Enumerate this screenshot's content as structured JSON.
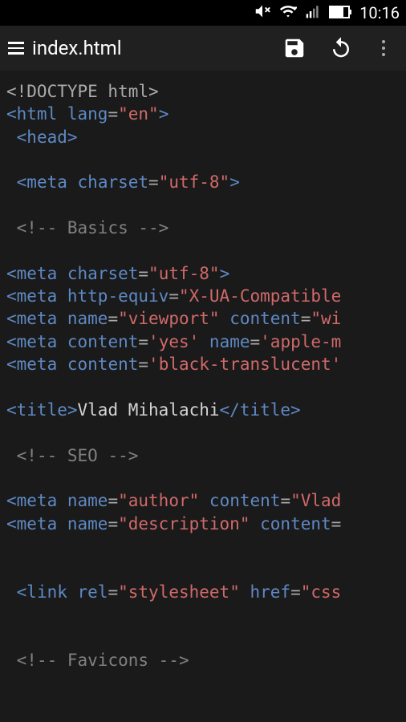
{
  "status": {
    "time": "10:16"
  },
  "appbar": {
    "filename": "index.html"
  },
  "code": {
    "lines": [
      {
        "indent": 0,
        "kind": "doctype",
        "text": "<!DOCTYPE html>"
      },
      {
        "indent": 0,
        "kind": "open",
        "tag": "html",
        "attrs": [
          [
            "lang",
            "\"en\""
          ]
        ]
      },
      {
        "indent": 1,
        "kind": "open",
        "tag": "head"
      },
      {
        "indent": 0,
        "kind": "blank"
      },
      {
        "indent": 1,
        "kind": "self",
        "tag": "meta",
        "attrs": [
          [
            "charset",
            "\"utf-8\""
          ]
        ]
      },
      {
        "indent": 0,
        "kind": "blank"
      },
      {
        "indent": 1,
        "kind": "comment",
        "text": "<!-- Basics -->"
      },
      {
        "indent": 0,
        "kind": "blank"
      },
      {
        "indent": 0,
        "kind": "self",
        "tag": "meta",
        "attrs": [
          [
            "charset",
            "\"utf-8\""
          ]
        ]
      },
      {
        "indent": 0,
        "kind": "self-noclose",
        "tag": "meta",
        "attrs": [
          [
            "http-equiv",
            "\"X-UA-Compatible"
          ]
        ]
      },
      {
        "indent": 0,
        "kind": "self-noclose",
        "tag": "meta",
        "attrs": [
          [
            "name",
            "\"viewport\""
          ],
          [
            "content",
            "\"wi"
          ]
        ]
      },
      {
        "indent": 0,
        "kind": "self-noclose",
        "tag": "meta",
        "attrs": [
          [
            "content",
            "'yes'"
          ],
          [
            "name",
            "'apple-m"
          ]
        ]
      },
      {
        "indent": 0,
        "kind": "self-noclose",
        "tag": "meta",
        "attrs": [
          [
            "content",
            "'black-translucent'"
          ]
        ]
      },
      {
        "indent": 0,
        "kind": "blank"
      },
      {
        "indent": 0,
        "kind": "element",
        "tag": "title",
        "inner": "Vlad Mihalachi"
      },
      {
        "indent": 0,
        "kind": "blank"
      },
      {
        "indent": 1,
        "kind": "comment",
        "text": "<!-- SEO -->"
      },
      {
        "indent": 0,
        "kind": "blank"
      },
      {
        "indent": 0,
        "kind": "self-noclose",
        "tag": "meta",
        "attrs": [
          [
            "name",
            "\"author\""
          ],
          [
            "content",
            "\"Vlad"
          ]
        ]
      },
      {
        "indent": 0,
        "kind": "self-noclose",
        "tag": "meta",
        "attrs": [
          [
            "name",
            "\"description\""
          ],
          [
            "content",
            ""
          ]
        ]
      },
      {
        "indent": 0,
        "kind": "blank"
      },
      {
        "indent": 0,
        "kind": "blank"
      },
      {
        "indent": 1,
        "kind": "self-noclose",
        "tag": "link",
        "attrs": [
          [
            "rel",
            "\"stylesheet\""
          ],
          [
            "href",
            "\"css"
          ]
        ]
      },
      {
        "indent": 0,
        "kind": "blank"
      },
      {
        "indent": 0,
        "kind": "blank"
      },
      {
        "indent": 1,
        "kind": "comment",
        "text": "<!-- Favicons -->"
      }
    ]
  }
}
